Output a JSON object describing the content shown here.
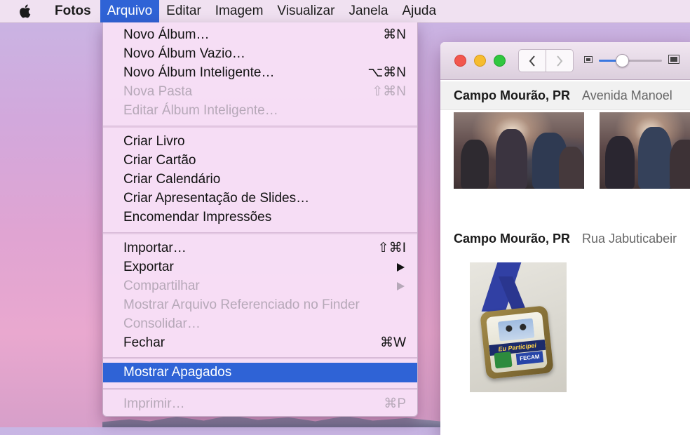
{
  "menubar": {
    "apple_icon": "apple-logo-icon",
    "items": [
      {
        "label": "Fotos"
      },
      {
        "label": "Arquivo"
      },
      {
        "label": "Editar"
      },
      {
        "label": "Imagem"
      },
      {
        "label": "Visualizar"
      },
      {
        "label": "Janela"
      },
      {
        "label": "Ajuda"
      }
    ],
    "active_item": "Arquivo"
  },
  "file_menu": {
    "groups": [
      [
        {
          "label": "Novo Álbum…",
          "shortcut": "⌘N",
          "enabled": true
        },
        {
          "label": "Novo Álbum Vazio…",
          "shortcut": "",
          "enabled": true
        },
        {
          "label": "Novo Álbum Inteligente…",
          "shortcut": "⌥⌘N",
          "enabled": true
        },
        {
          "label": "Nova Pasta",
          "shortcut": "⇧⌘N",
          "enabled": false
        },
        {
          "label": "Editar Álbum Inteligente…",
          "shortcut": "",
          "enabled": false
        }
      ],
      [
        {
          "label": "Criar Livro",
          "enabled": true
        },
        {
          "label": "Criar Cartão",
          "enabled": true
        },
        {
          "label": "Criar Calendário",
          "enabled": true
        },
        {
          "label": "Criar Apresentação de Slides…",
          "enabled": true
        },
        {
          "label": "Encomendar Impressões",
          "enabled": true
        }
      ],
      [
        {
          "label": "Importar…",
          "shortcut": "⇧⌘I",
          "enabled": true
        },
        {
          "label": "Exportar",
          "submenu": true,
          "enabled": true
        },
        {
          "label": "Compartilhar",
          "submenu": true,
          "enabled": false
        },
        {
          "label": "Mostrar Arquivo Referenciado no Finder",
          "enabled": false
        },
        {
          "label": "Consolidar…",
          "enabled": false
        },
        {
          "label": "Fechar",
          "shortcut": "⌘W",
          "enabled": true
        }
      ],
      [
        {
          "label": "Mostrar Apagados",
          "enabled": true,
          "highlighted": true
        }
      ],
      [
        {
          "label": "Imprimir…",
          "shortcut": "⌘P",
          "enabled": false
        }
      ]
    ]
  },
  "photos_window": {
    "zoom_slider_value": 0.35,
    "sections": [
      {
        "place": "Campo Mourão, PR",
        "street": "Avenida Manoel"
      },
      {
        "place": "Campo Mourão, PR",
        "street": "Rua Jabuticabeir"
      }
    ],
    "medal_text": {
      "band": "Eu Participei",
      "badge": "FECAM"
    }
  },
  "colors": {
    "highlight": "#2f63d6",
    "menu_bg": "#f7dff6",
    "disabled_text": "#b6a8b8"
  }
}
